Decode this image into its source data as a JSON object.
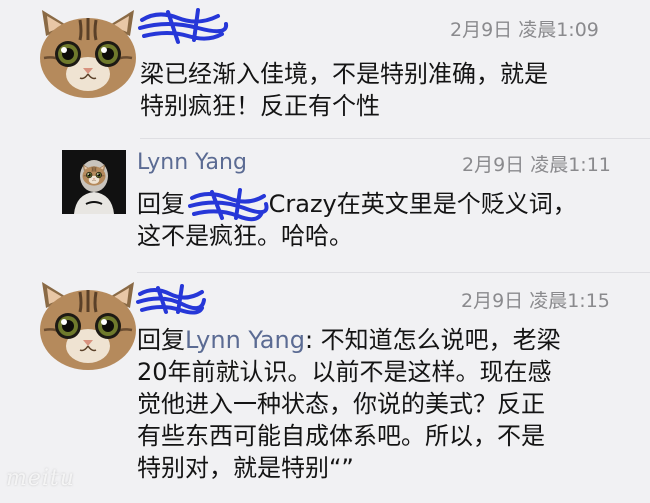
{
  "comments": [
    {
      "author": "",
      "time": "2月9日 凌晨1:09",
      "text_line1": "梁已经渐入佳境，不是特别准确，就是",
      "text_line2": "特别疯狂！反正有个性"
    },
    {
      "author": "Lynn Yang",
      "time": "2月9日 凌晨1:11",
      "reply_prefix": "回复",
      "text_line1": " Crazy在英文里是个贬义词，",
      "text_line2": "这不是疯狂。哈哈。"
    },
    {
      "author": "",
      "time": "2月9日 凌晨1:15",
      "reply_prefix": "回复",
      "reply_target": "Lynn Yang",
      "text_line1": ": 不知道怎么说吧，老梁",
      "text_line2": "20年前就认识。以前不是这样。现在感",
      "text_line3": "觉他进入一种状态，你说的美式？反正",
      "text_line4": "有些东西可能自成体系吧。所以，不是",
      "text_line5": "特别对，就是特别“”"
    }
  ],
  "watermark": "meitu",
  "colors": {
    "background": "#f1f1f3",
    "name": "#5b6b93",
    "time": "#8a8a8d",
    "text": "#141414",
    "scribble": "#2637d8"
  },
  "icons": [
    "cat-avatar-icon",
    "person-avatar-icon",
    "redaction-scribble"
  ]
}
